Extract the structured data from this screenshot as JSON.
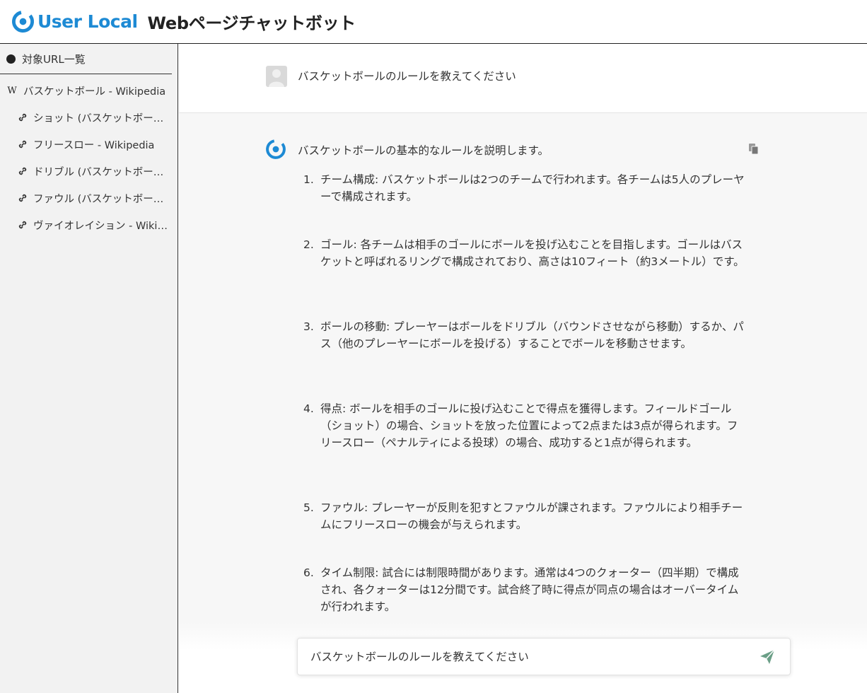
{
  "header": {
    "logo_text": "User Local",
    "app_title": "Webページチャットボット",
    "brand_color": "#1d8ad4"
  },
  "sidebar": {
    "heading": "対象URL一覧",
    "items": [
      {
        "label": "バスケットボール - Wikipedia",
        "icon": "wikipedia-icon"
      },
      {
        "label": "ショット (バスケットボール) - Wikipedia",
        "icon": "link-icon"
      },
      {
        "label": "フリースロー - Wikipedia",
        "icon": "link-icon"
      },
      {
        "label": "ドリブル (バスケットボール) - Wikipedia",
        "icon": "link-icon"
      },
      {
        "label": "ファウル (バスケットボール) - Wikipedia",
        "icon": "link-icon"
      },
      {
        "label": "ヴァイオレイション - Wikipedia",
        "icon": "link-icon"
      }
    ]
  },
  "chat": {
    "user_message": "バスケットボールのルールを教えてください",
    "bot_intro": "バスケットボールの基本的なルールを説明します。",
    "answers": [
      {
        "num": "1.",
        "text": "チーム構成: バスケットボールは2つのチームで行われます。各チームは5人のプレーヤーで構成されます。"
      },
      {
        "num": "2.",
        "text": "ゴール: 各チームは相手のゴールにボールを投げ込むことを目指します。ゴールはバスケットと呼ばれるリングで構成されており、高さは10フィート（約3メートル）です。"
      },
      {
        "num": "3.",
        "text": "ボールの移動: プレーヤーはボールをドリブル（バウンドさせながら移動）するか、パス（他のプレーヤーにボールを投げる）することでボールを移動させます。"
      },
      {
        "num": "4.",
        "text": "得点: ボールを相手のゴールに投げ込むことで得点を獲得します。フィールドゴール（ショット）の場合、ショットを放った位置によって2点または3点が得られます。フリースロー（ペナルティによる投球）の場合、成功すると1点が得られます。"
      },
      {
        "num": "5.",
        "text": "ファウル: プレーヤーが反則を犯すとファウルが課されます。ファウルにより相手チームにフリースローの機会が与えられます。"
      },
      {
        "num": "6.",
        "text": "タイム制限: 試合には制限時間があります。通常は4つのクォーター（四半期）で構成され、各クォーターは12分間です。試合終了時に得点が同点の場合はオーバータイムが行われます。"
      }
    ]
  },
  "input": {
    "value": "バスケットボールのルールを教えてください",
    "send_color": "#6b9f87"
  }
}
